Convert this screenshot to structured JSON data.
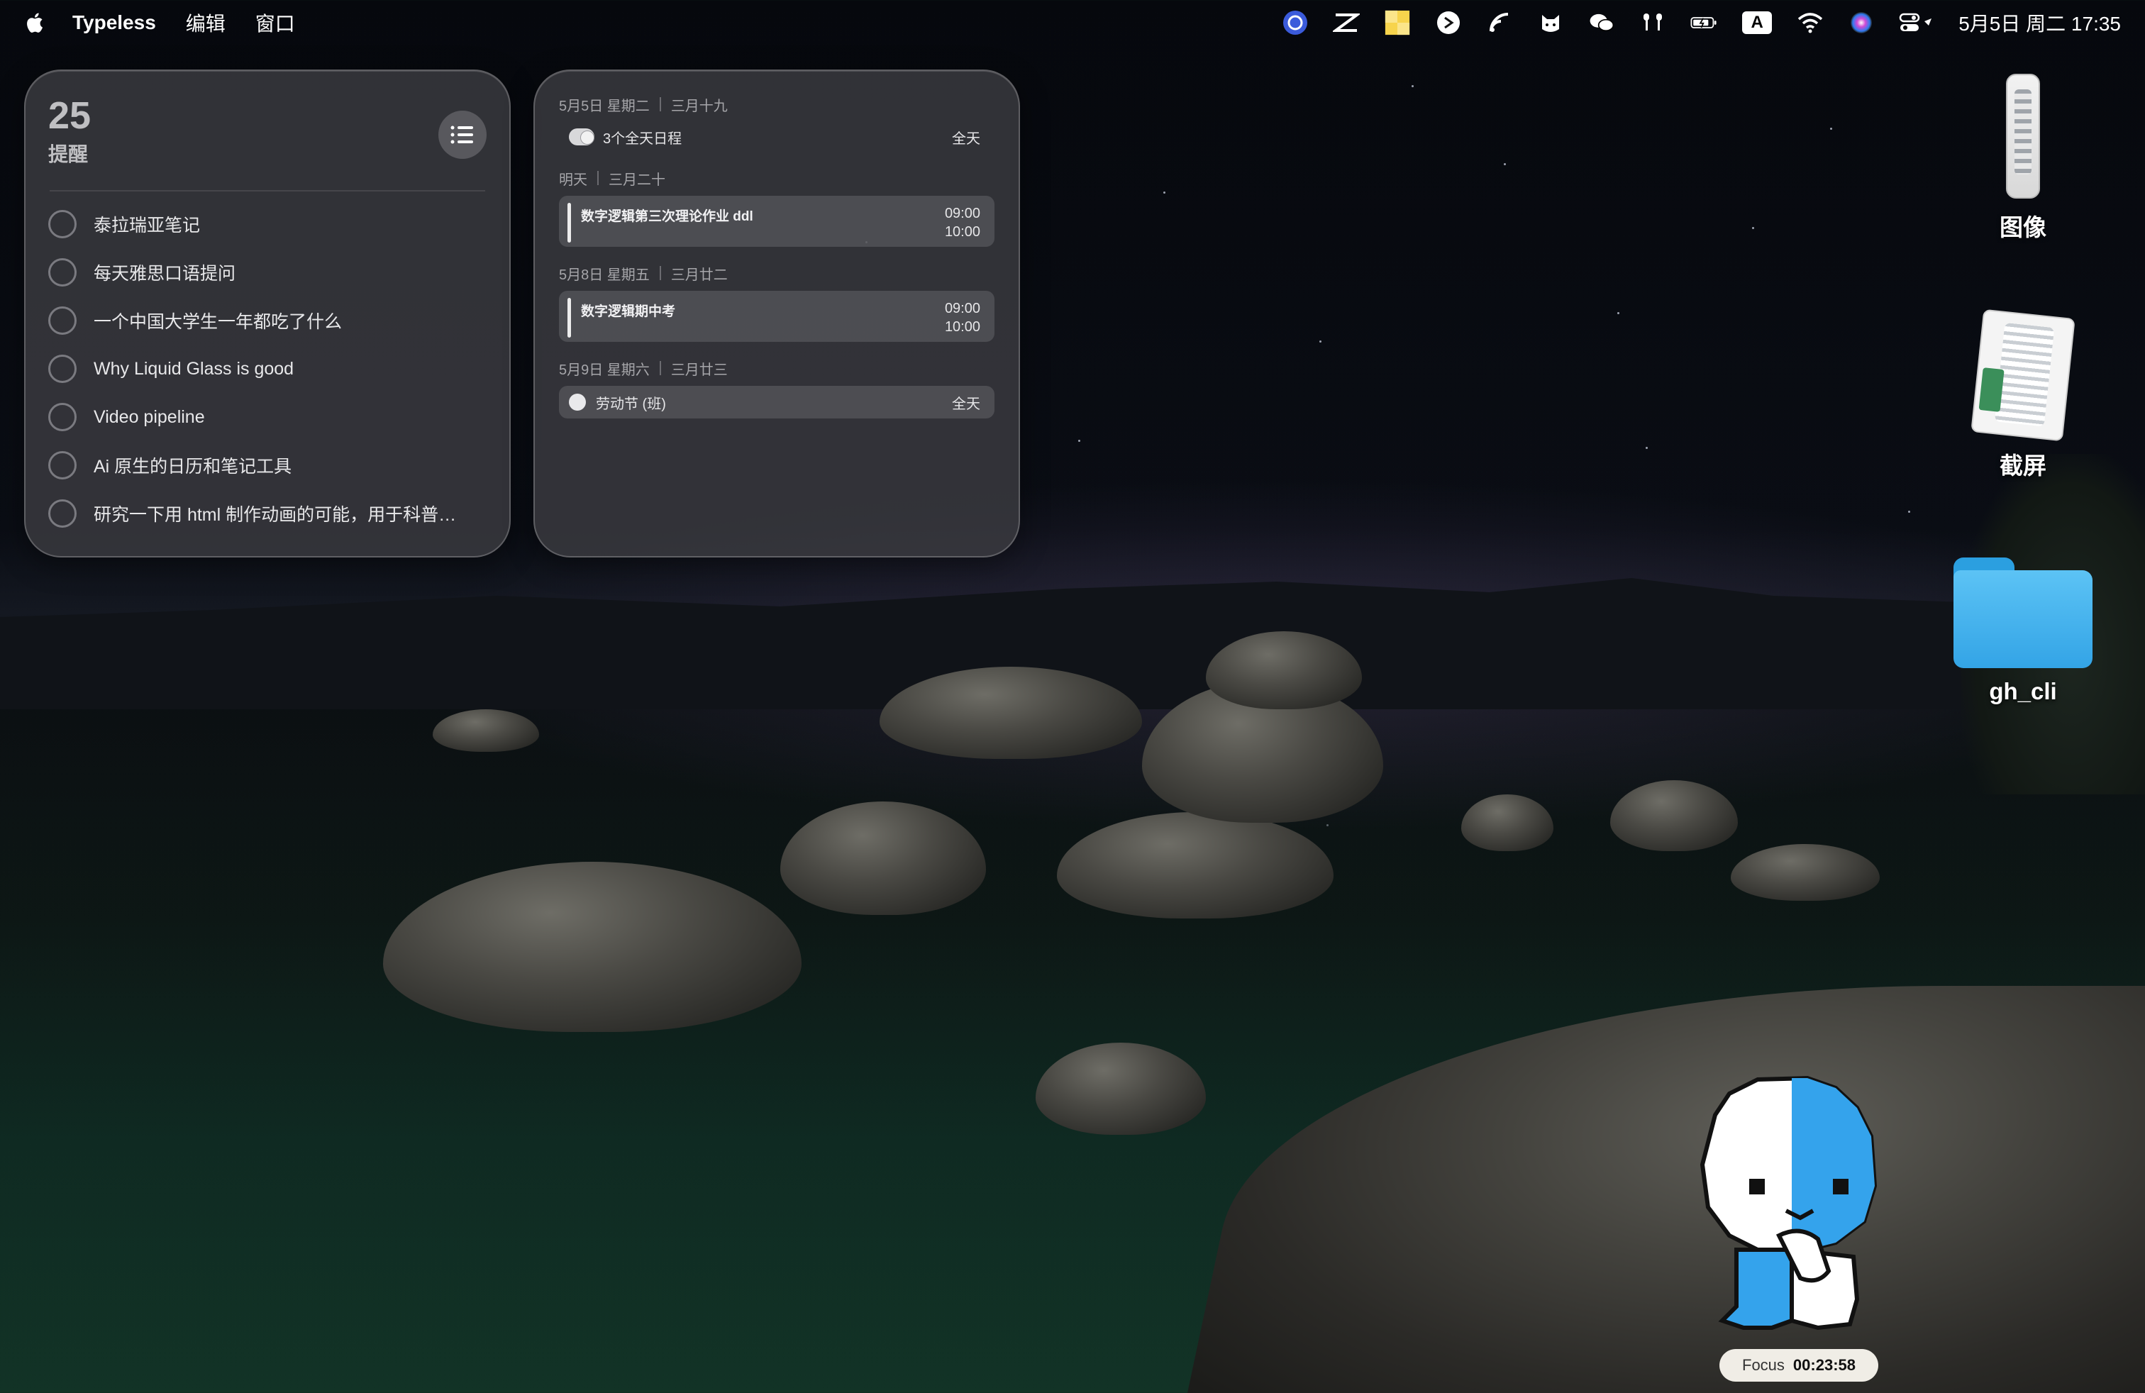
{
  "menubar": {
    "app_name": "Typeless",
    "menus": [
      "编辑",
      "窗口"
    ],
    "status_icons": [
      "app-icon-1",
      "capcut-icon",
      "sticky-notes-icon",
      "app-icon-2",
      "feed-icon",
      "cat-icon",
      "wechat-icon",
      "airpods-icon",
      "battery-icon",
      "input-source-icon",
      "wifi-icon",
      "siri-icon",
      "control-center-icon"
    ],
    "input_source": "A",
    "clock": "5月5日 周二  17:35"
  },
  "reminders": {
    "count": "25",
    "title": "提醒",
    "items": [
      "泰拉瑞亚笔记",
      "每天雅思口语提问",
      "一个中国大学生一年都吃了什么",
      "Why Liquid Glass is good",
      "Video pipeline",
      "Ai 原生的日历和笔记工具",
      "研究一下用 html 制作动画的可能，用于科普…"
    ]
  },
  "calendar": {
    "day1": {
      "date": "5月5日 星期二",
      "lunar": "三月十九",
      "allday_label": "3个全天日程",
      "allday_tag": "全天"
    },
    "day2": {
      "date": "明天",
      "lunar": "三月二十",
      "event_title": "数字逻辑第三次理论作业 ddl",
      "start": "09:00",
      "end": "10:00"
    },
    "day3": {
      "date": "5月8日 星期五",
      "lunar": "三月廿二",
      "event_title": "数字逻辑期中考",
      "start": "09:00",
      "end": "10:00"
    },
    "day4": {
      "date": "5月9日 星期六",
      "lunar": "三月廿三",
      "holiday": "劳动节 (班)",
      "holiday_tag": "全天"
    }
  },
  "desktop": {
    "icons": [
      {
        "label": "图像"
      },
      {
        "label": "截屏"
      },
      {
        "label": "gh_cli"
      }
    ]
  },
  "focus": {
    "label": "Focus",
    "timer": "00:23:58"
  },
  "colors": {
    "accent_blue": "#2b9fe0",
    "widget_bg": "#3e3e42"
  }
}
